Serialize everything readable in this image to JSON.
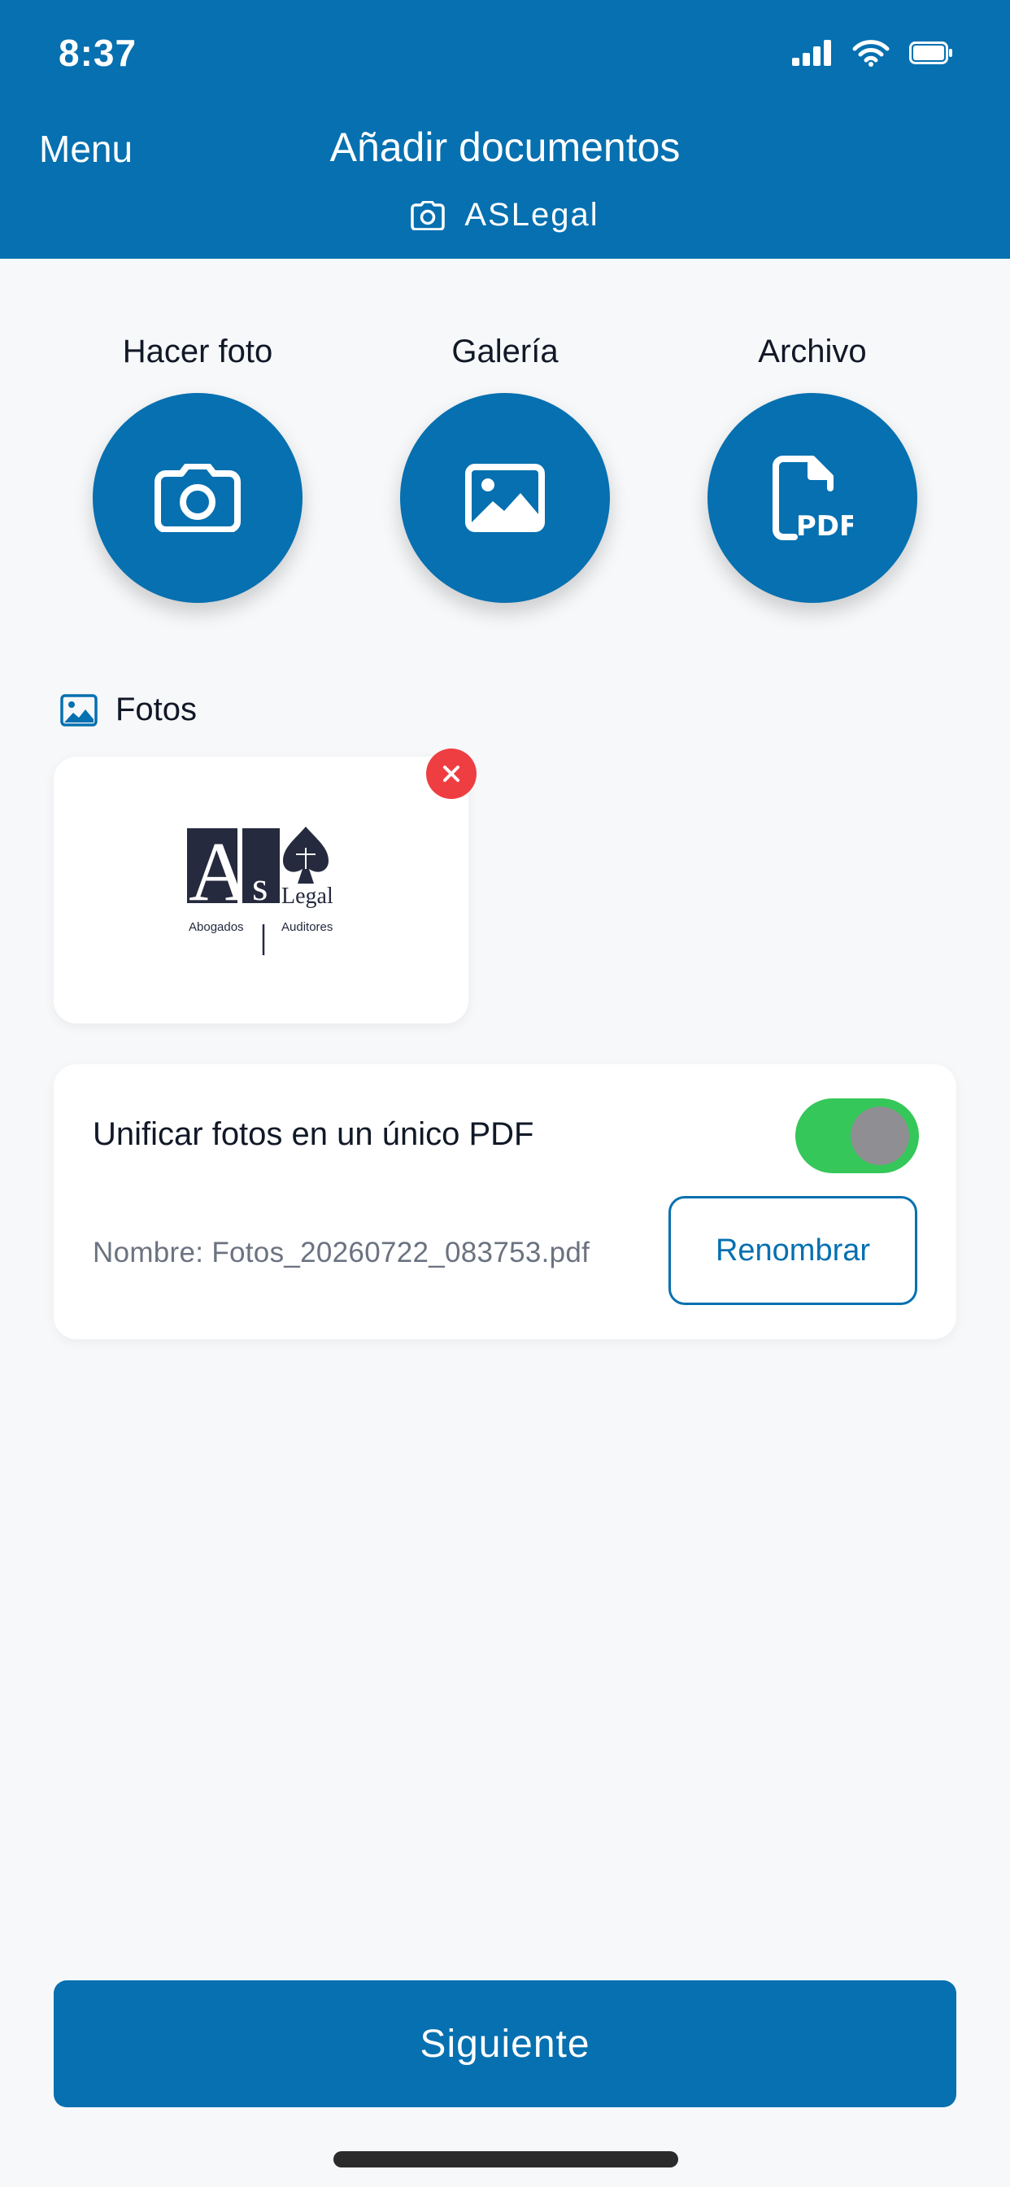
{
  "status_bar": {
    "time": "8:37"
  },
  "nav": {
    "menu_label": "Menu",
    "title": "Añadir documentos",
    "subtitle": "ASLegal"
  },
  "actions": [
    {
      "label": "Hacer foto",
      "icon": "camera-icon"
    },
    {
      "label": "Galería",
      "icon": "image-icon"
    },
    {
      "label": "Archivo",
      "icon": "pdf-file-icon",
      "icon_text": "PDF"
    }
  ],
  "photos_section": {
    "title": "Fotos",
    "items": [
      {
        "thumbnail": "aslegal-logo",
        "logo_text": {
          "brand_a": "A",
          "brand_s": "s",
          "brand_legal": "Legal",
          "left_caption": "Abogados",
          "right_caption": "Auditores"
        }
      }
    ]
  },
  "unify": {
    "label": "Unificar fotos en un único PDF",
    "enabled": true,
    "filename": "Nombre: Fotos_20260722_083753.pdf",
    "rename_label": "Renombrar"
  },
  "footer": {
    "next_label": "Siguiente"
  },
  "colors": {
    "primary": "#0670b0",
    "toggle_on": "#35c759",
    "danger": "#ef3e42",
    "background": "#f7f8fa"
  }
}
